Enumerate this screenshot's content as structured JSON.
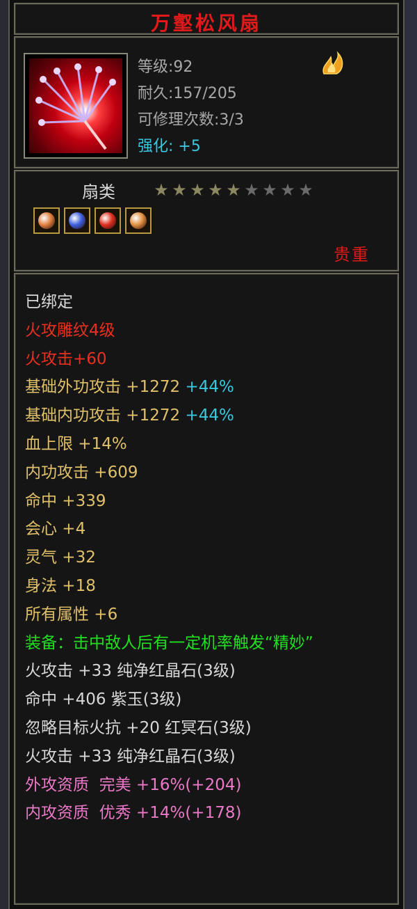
{
  "item": {
    "name": "万壑松风扇",
    "level": "等级:92",
    "durability": "耐久:157/205",
    "repair_count": "可修理次数:3/3",
    "enhance_label": "强化:",
    "enhance_value": "+5",
    "type": "扇类",
    "rarity": "贵重",
    "stars_filled": 5,
    "stars_total": 9
  },
  "gems": [
    {
      "icon": "orange-gem-icon",
      "color": "#e08040"
    },
    {
      "icon": "blue-gem-icon",
      "color": "#4060e0"
    },
    {
      "icon": "red-gem-icon",
      "color": "#e03020"
    },
    {
      "icon": "orange-gem-icon",
      "color": "#e09040"
    }
  ],
  "attributes": {
    "bound": "已绑定",
    "fire_carving": "火攻雕纹4级",
    "fire_attack": "火攻击+60",
    "base_outer_label": "基础外功攻击 +1272 ",
    "base_outer_pct": "+44%",
    "base_inner_label": "基础内功攻击 +1272 ",
    "base_inner_pct": "+44%",
    "hp_max": "血上限 +14%",
    "inner_attack": "内功攻击 +609",
    "hit": "命中 +339",
    "crit": "会心 +4",
    "spirit": "灵气 +32",
    "agility": "身法 +18",
    "all_attr": "所有属性 +6",
    "equip_effect": "装备：击中敌人后有一定机率触发“精妙”",
    "gem_line_1": "火攻击 +33 纯净红晶石(3级)",
    "gem_line_2": "命中 +406 紫玉(3级)",
    "gem_line_3": "忽略目标火抗 +20 红冥石(3级)",
    "gem_line_4": "火攻击 +33 纯净红晶石(3级)",
    "outer_quality": "外攻资质  完美 +16%(+204)",
    "inner_quality": "内攻资质  优秀 +14%(+178)"
  },
  "colors": {
    "title_red": "#e01a1a",
    "stat_grey": "#a8a8a8",
    "cyan": "#39c8e0",
    "gold": "#e0c068",
    "green": "#20e020",
    "pink": "#ec78c8",
    "red": "#e83020"
  }
}
